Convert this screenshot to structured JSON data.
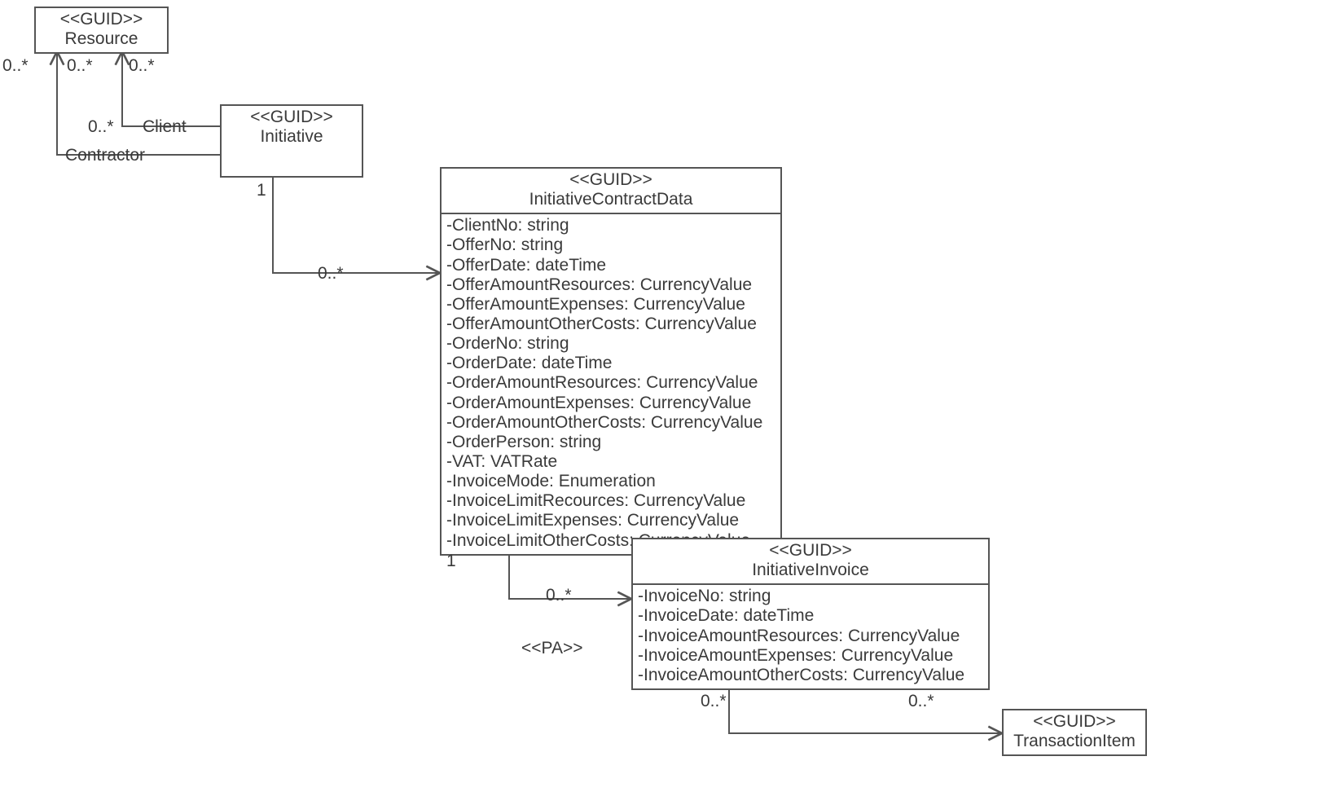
{
  "classes": {
    "resource": {
      "stereotype": "<<GUID>>",
      "name": "Resource"
    },
    "initiative": {
      "stereotype": "<<GUID>>",
      "name": "Initiative"
    },
    "contract": {
      "stereotype": "<<GUID>>",
      "name": "InitiativeContractData",
      "attributes": [
        "-ClientNo: string",
        "-OfferNo: string",
        "-OfferDate: dateTime",
        "-OfferAmountResources: CurrencyValue",
        "-OfferAmountExpenses: CurrencyValue",
        "-OfferAmountOtherCosts: CurrencyValue",
        "-OrderNo: string",
        "-OrderDate: dateTime",
        "-OrderAmountResources: CurrencyValue",
        "-OrderAmountExpenses: CurrencyValue",
        "-OrderAmountOtherCosts: CurrencyValue",
        "-OrderPerson: string",
        "-VAT: VATRate",
        "-InvoiceMode: Enumeration",
        "-InvoiceLimitRecources: CurrencyValue",
        "-InvoiceLimitExpenses: CurrencyValue",
        "-InvoiceLimitOtherCosts: CurrencyValue"
      ]
    },
    "invoice": {
      "stereotype": "<<GUID>>",
      "name": "InitiativeInvoice",
      "attributes": [
        "-InvoiceNo: string",
        "-InvoiceDate: dateTime",
        "-InvoiceAmountResources: CurrencyValue",
        "-InvoiceAmountExpenses: CurrencyValue",
        "-InvoiceAmountOtherCosts: CurrencyValue"
      ]
    },
    "transaction": {
      "stereotype": "<<GUID>>",
      "name": "TransactionItem"
    }
  },
  "labels": {
    "zero_star_a": "0..*",
    "zero_star_b": "0..*",
    "zero_star_c": "0..*",
    "zero_star_d": "0..*",
    "zero_star_e": "0..*",
    "zero_star_f": "0..*",
    "zero_star_g": "0..*",
    "zero_star_h": "0..*",
    "one_a": "1",
    "one_b": "1",
    "client": "Client",
    "contractor": "Contractor",
    "pa": "<<PA>>"
  }
}
